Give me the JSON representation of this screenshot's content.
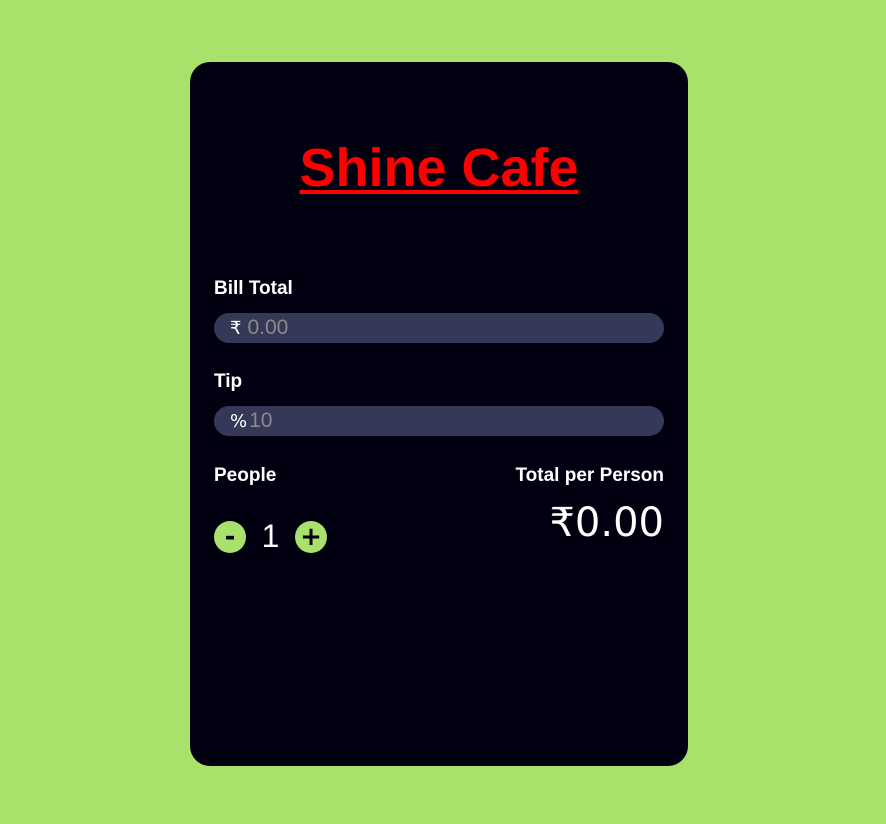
{
  "app": {
    "title": "Shine Cafe"
  },
  "bill": {
    "label": "Bill Total",
    "currency_symbol": "₹",
    "placeholder": "0.00"
  },
  "tip": {
    "label": "Tip",
    "percent_symbol": "%",
    "placeholder": "10"
  },
  "people": {
    "label": "People",
    "decrement_label": "-",
    "increment_label": "+",
    "count": "1"
  },
  "result": {
    "label": "Total per Person",
    "value": "₹0.00"
  },
  "colors": {
    "background": "#a8e26a",
    "card": "#000010",
    "title": "#ff0000",
    "field": "#363857",
    "button": "#a8e26a"
  }
}
